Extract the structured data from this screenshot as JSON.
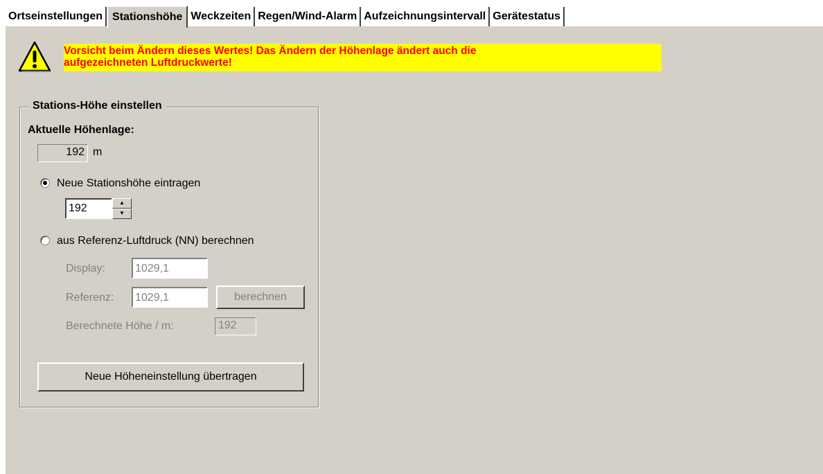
{
  "tabs": [
    {
      "label": "Ortseinstellungen",
      "active": false
    },
    {
      "label": "Stationshöhe",
      "active": true
    },
    {
      "label": "Weckzeiten",
      "active": false
    },
    {
      "label": "Regen/Wind-Alarm",
      "active": false
    },
    {
      "label": "Aufzeichnungsintervall",
      "active": false
    },
    {
      "label": "Gerätestatus",
      "active": false
    }
  ],
  "warning": {
    "icon": "warning-icon",
    "line1": "Vorsicht beim Ändern dieses Wertes! Das Ändern der Höhenlage ändert auch die",
    "line2": "aufgezeichneten Luftdruckwerte!",
    "background": "#ffff00",
    "text_color": "#ff0000"
  },
  "group": {
    "title": "Stations-Höhe einstellen",
    "current_label": "Aktuelle Höhenlage:",
    "current_value": "192",
    "current_unit": "m",
    "radio_manual": {
      "label": "Neue Stationshöhe eintragen",
      "checked": true
    },
    "manual_value": "192",
    "radio_reference": {
      "label": "aus Referenz-Luftdruck (NN) berechnen",
      "checked": false
    },
    "display_label": "Display:",
    "display_value": "1029,1",
    "reference_label": "Referenz:",
    "reference_value": "1029,1",
    "calculate_button": "berechnen",
    "computed_label": "Berechnete Höhe / m:",
    "computed_value": "192",
    "transfer_button": "Neue Höheneinstellung übertragen"
  }
}
